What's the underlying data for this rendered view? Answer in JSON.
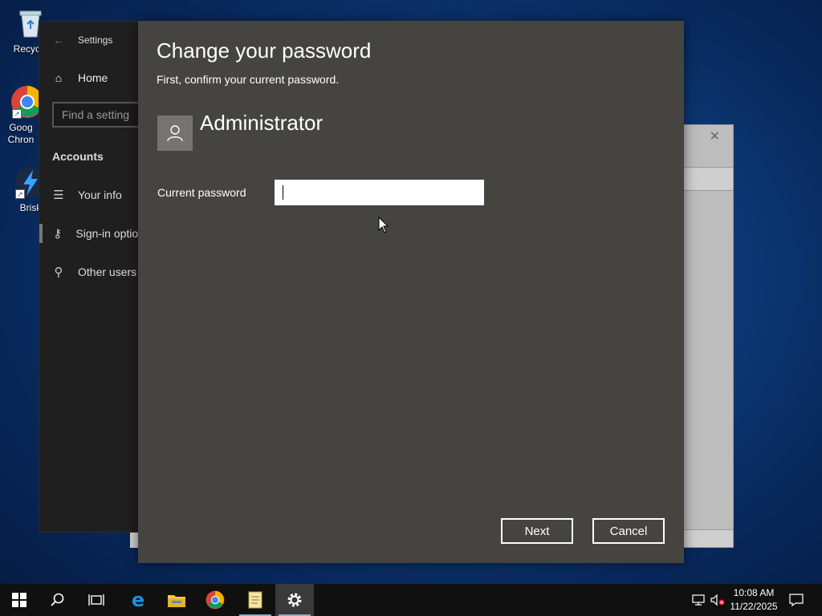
{
  "desktop": {
    "icons": [
      {
        "label": "Recycle",
        "icon": "recycle-bin-icon"
      },
      {
        "label": "Goog Chron",
        "icon": "chrome-icon"
      },
      {
        "label": "Brisk",
        "icon": "brisk-icon"
      }
    ]
  },
  "settings": {
    "title": "Settings",
    "home_label": "Home",
    "search_placeholder": "Find a setting",
    "section": "Accounts",
    "nav": [
      {
        "label": "Your info",
        "icon": "person-card-icon"
      },
      {
        "label": "Sign-in options",
        "icon": "key-icon"
      },
      {
        "label": "Other users",
        "icon": "person-add-icon"
      }
    ]
  },
  "dialog": {
    "title": "Change your password",
    "subtitle": "First, confirm your current password.",
    "username": "Administrator",
    "password_label": "Current password",
    "password_value": "",
    "next_label": "Next",
    "cancel_label": "Cancel"
  },
  "taskbar": {
    "items": [
      "start-icon",
      "search-icon",
      "task-view-icon",
      "edge-icon",
      "file-explorer-icon",
      "chrome-icon",
      "notepad-icon",
      "settings-gear-icon"
    ],
    "time": "10:08 AM",
    "date": "11/22/2025"
  },
  "colors": {
    "dialog_bg": "#464441",
    "settings_bg": "#1f1f1f",
    "taskbar_bg": "#101010"
  }
}
